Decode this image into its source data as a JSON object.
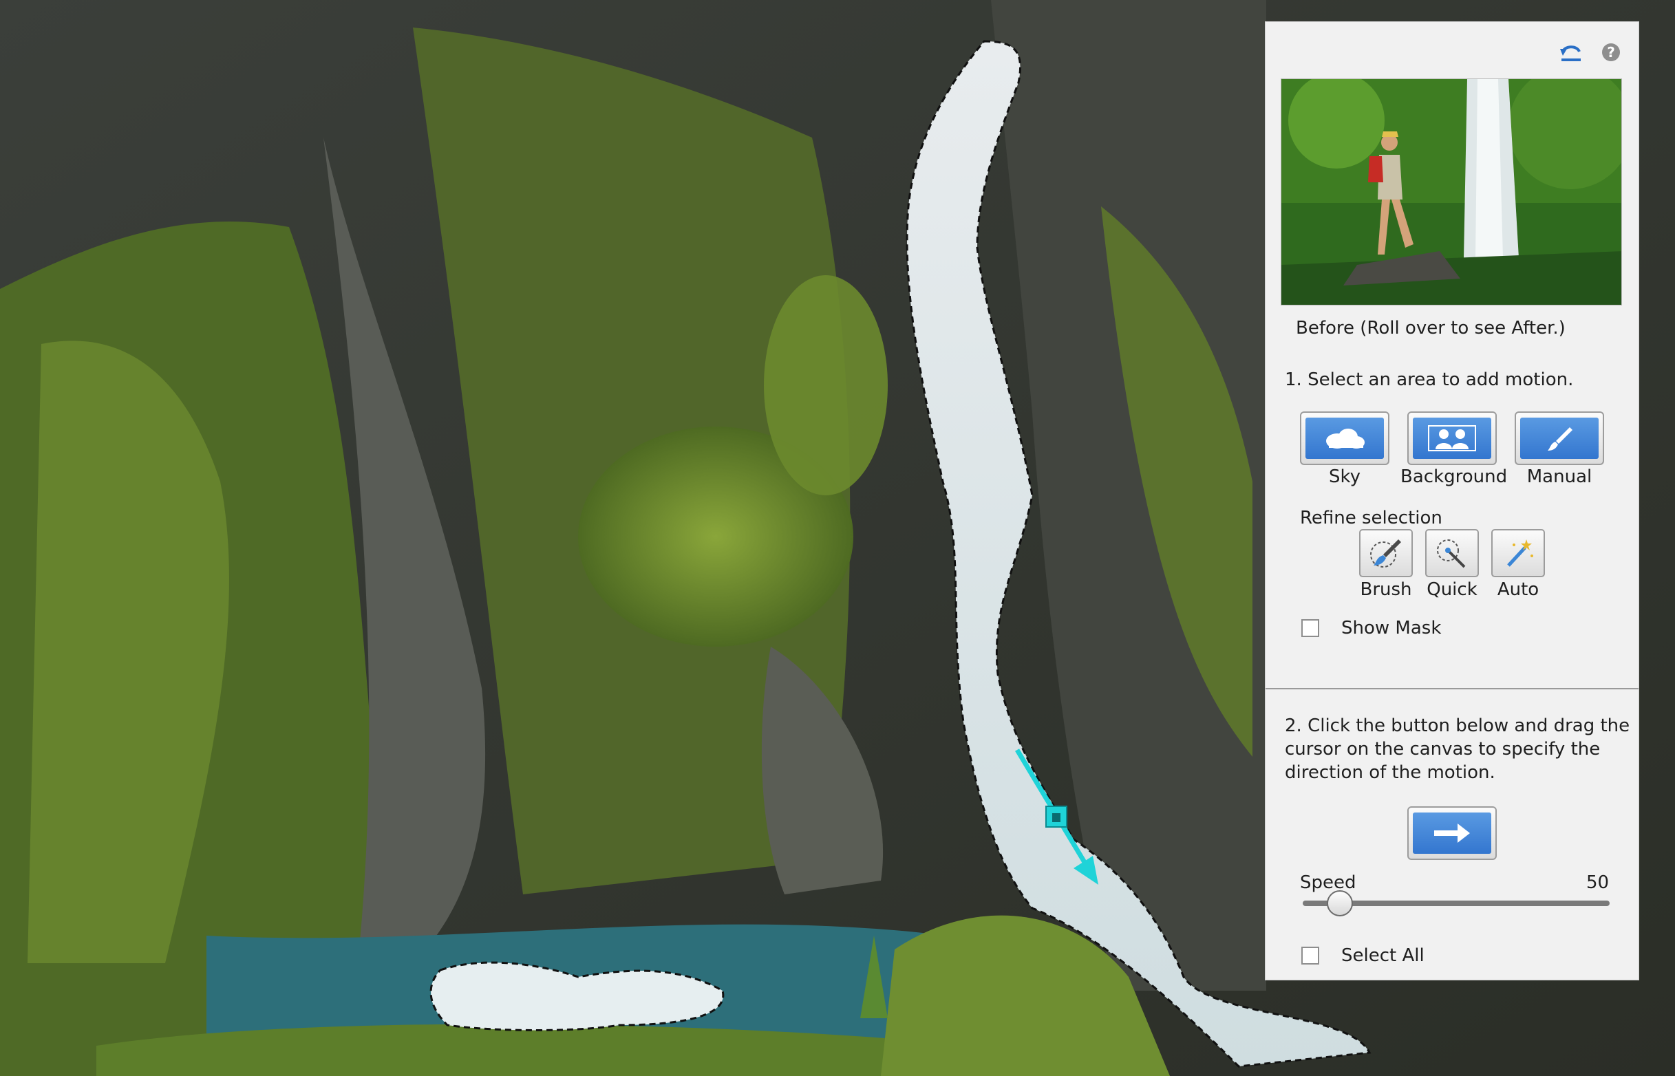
{
  "panel": {
    "preview_caption": "Before (Roll over to see After.)",
    "step1_label": "1. Select an area to add motion.",
    "select_buttons": [
      {
        "label": "Sky",
        "icon": "sky-cloud-icon"
      },
      {
        "label": "Background",
        "icon": "background-people-icon"
      },
      {
        "label": "Manual",
        "icon": "manual-brush-icon"
      }
    ],
    "refine_label": "Refine selection",
    "refine_buttons": [
      {
        "label": "Brush",
        "icon": "refine-brush-icon"
      },
      {
        "label": "Quick",
        "icon": "quick-select-icon"
      },
      {
        "label": "Auto",
        "icon": "auto-wand-icon"
      }
    ],
    "show_mask_label": "Show Mask",
    "show_mask_checked": false,
    "step2_line1": "2. Click the button below and drag the",
    "step2_line2": "cursor on the canvas to specify the",
    "step2_line3": "direction of the motion.",
    "motion_button_icon": "arrow-right-icon",
    "speed_label": "Speed",
    "speed_value": "50",
    "speed_fraction": 0.12,
    "select_all_label": "Select All",
    "select_all_checked": false,
    "header_icons": [
      "reset-icon",
      "help-icon"
    ]
  },
  "canvas": {
    "motion_arrow_color": "#1fd3d8",
    "selection_outline": "dashed marching ants"
  }
}
